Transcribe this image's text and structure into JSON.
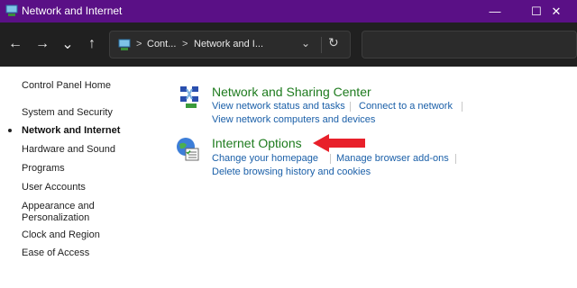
{
  "window": {
    "title": "Network and Internet",
    "min_glyph": "—",
    "max_glyph": "☐",
    "close_glyph": "✕"
  },
  "nav": {
    "back_glyph": "←",
    "forward_glyph": "→",
    "recent_glyph": "⌄",
    "up_glyph": "↑",
    "breadcrumb_sep": ">",
    "breadcrumb": [
      "Cont...",
      "Network and I..."
    ],
    "dropdown_glyph": "⌄",
    "refresh_glyph": "↻",
    "search_placeholder": ""
  },
  "sidebar": {
    "items": [
      {
        "label": "Control Panel Home",
        "active": false
      },
      {
        "label": "System and Security",
        "active": false
      },
      {
        "label": "Network and Internet",
        "active": true
      },
      {
        "label": "Hardware and Sound",
        "active": false
      },
      {
        "label": "Programs",
        "active": false
      },
      {
        "label": "User Accounts",
        "active": false
      },
      {
        "label": "Appearance and",
        "active": false
      },
      {
        "label": "Personalization",
        "active": false
      },
      {
        "label": "Clock and Region",
        "active": false
      },
      {
        "label": "Ease of Access",
        "active": false
      }
    ]
  },
  "categories": [
    {
      "title": "Network and Sharing Center",
      "icon": "network-sharing-icon",
      "tasks": [
        "View network status and tasks",
        "Connect to a network",
        "View network computers and devices"
      ]
    },
    {
      "title": "Internet Options",
      "icon": "internet-options-icon",
      "tasks": [
        "Change your homepage",
        "Manage browser add-ons",
        "Delete browsing history and cookies"
      ]
    }
  ],
  "annotation": {
    "icon": "red-arrow-icon",
    "color": "#e8202a"
  },
  "colors": {
    "titlebar": "#5a1086",
    "navbar": "#202020",
    "category": "#1e7b1e",
    "link": "#1a5fa8"
  }
}
